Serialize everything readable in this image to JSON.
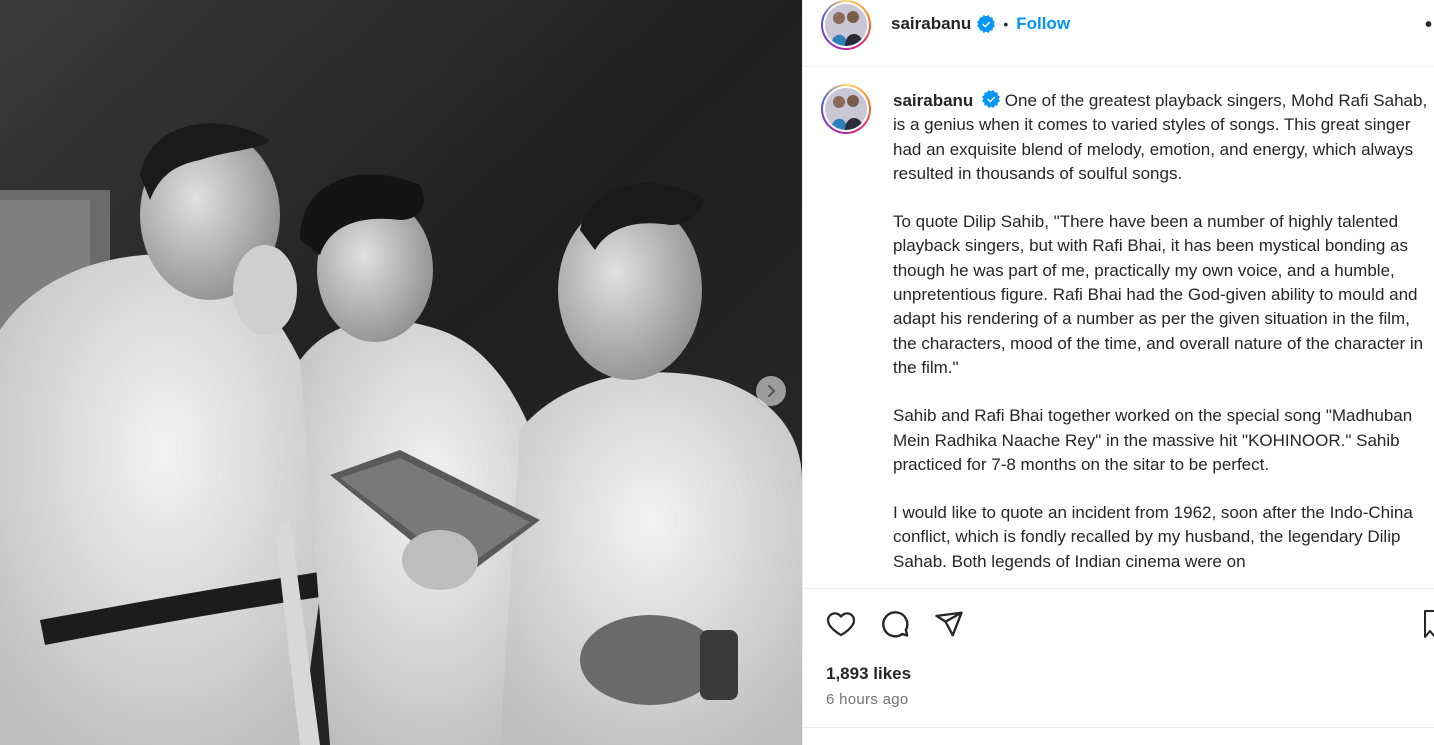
{
  "post": {
    "username": "sairabanu",
    "follow_label": "Follow",
    "separator": "•",
    "more_label": "•",
    "caption_paragraphs": [
      "One of the greatest playback singers, Mohd Rafi Sahab, is a genius when it comes to varied styles of songs. This great singer had an exquisite blend of melody, emotion, and energy, which always resulted in thousands of soulful songs.",
      "To quote Dilip Sahib, \"There have been a number of highly talented playback singers, but with Rafi Bhai, it has been mystical bonding as though he was part of me, practically my own voice, and a humble, unpretentious figure. Rafi Bhai had the God-given ability to mould and adapt his rendering of a number as per the given situation in the film, the characters, mood of the time, and overall nature of the character in the film.\"",
      "Sahib and Rafi Bhai together worked on the special song \"Madhuban Mein Radhika Naache Rey\" in the massive hit \"KOHINOOR.\" Sahib practiced for 7-8 months on the sitar to be perfect.",
      "I would like to quote an incident from 1962, soon after the Indo-China conflict, which is fondly recalled by my husband, the legendary Dilip Sahab. Both legends of Indian cinema were on"
    ],
    "likes": "1,893 likes",
    "time_ago": "6 hours ago"
  },
  "icons": {
    "verified": "verified-badge-icon",
    "like": "heart-icon",
    "comment": "comment-icon",
    "share": "share-icon",
    "save": "bookmark-icon",
    "next": "chevron-right-icon"
  },
  "colors": {
    "accent": "#0095f6",
    "text": "#262626",
    "muted": "#737373",
    "divider": "#efefef"
  }
}
